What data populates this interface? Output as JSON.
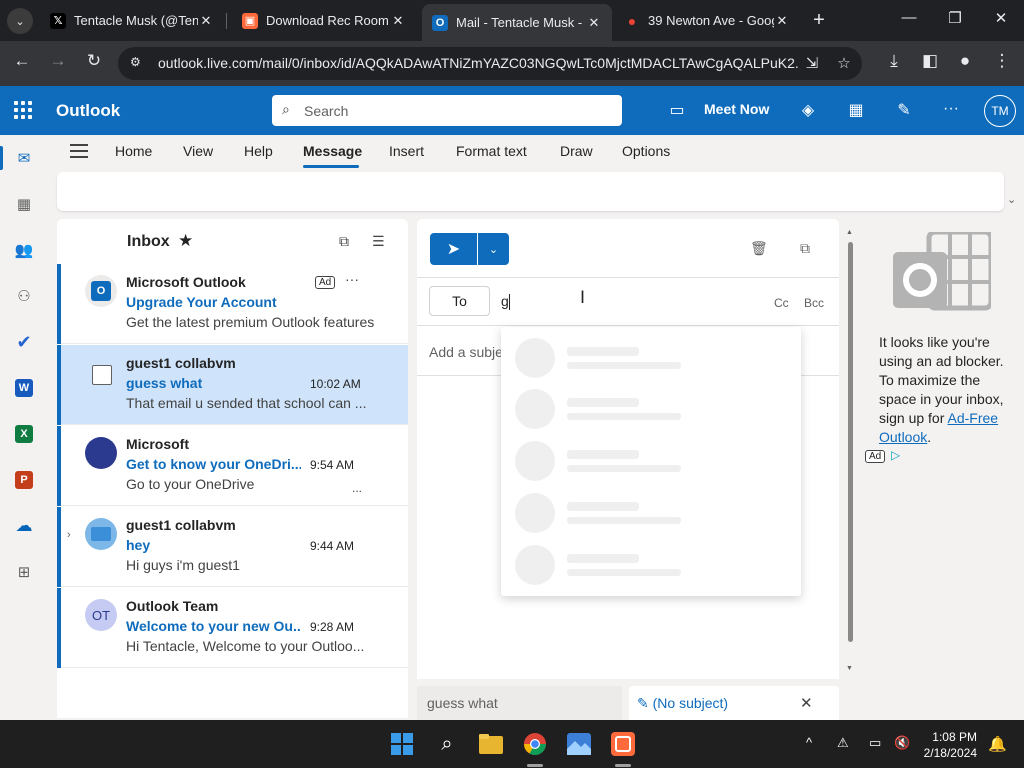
{
  "browser": {
    "tabs": [
      {
        "title": "Tentacle Musk (@Tenta",
        "icon": "x-logo-icon",
        "active": false
      },
      {
        "title": "Download Rec Room",
        "icon": "recroom-icon",
        "active": false
      },
      {
        "title": "Mail - Tentacle Musk -",
        "icon": "outlook-icon",
        "active": true
      },
      {
        "title": "39 Newton Ave - Goog",
        "icon": "maps-pin-icon",
        "active": false
      }
    ],
    "url": "outlook.live.com/mail/0/inbox/id/AQQkADAwATNiZmYAZC03NGQwLTc0MjctMDACLTAwCgAQALPuK2..."
  },
  "outlook": {
    "app_name": "Outlook",
    "search_placeholder": "Search",
    "meet_now": "Meet Now",
    "avatar_initials": "TM",
    "ribbon_tabs": [
      "Home",
      "View",
      "Help",
      "Message",
      "Insert",
      "Format text",
      "Draw",
      "Options"
    ],
    "active_ribbon_tab": "Message"
  },
  "list": {
    "title": "Inbox",
    "items": [
      {
        "sender": "Microsoft Outlook",
        "subject": "Upgrade Your Account",
        "time": "",
        "preview": "Get the latest premium Outlook features",
        "ad": "Ad",
        "more": "···"
      },
      {
        "sender": "guest1 collabvm",
        "subject": "guess what",
        "time": "10:02 AM",
        "preview": "That email u sended that school can ..."
      },
      {
        "sender": "Microsoft",
        "subject": "Get to know your OneDri...",
        "time": "9:54 AM",
        "preview": "Go to your OneDrive",
        "ellipsis": "..."
      },
      {
        "sender": "guest1 collabvm",
        "subject": "hey",
        "time": "9:44 AM",
        "preview": "Hi guys i'm guest1"
      },
      {
        "sender": "Outlook Team",
        "subject": "Welcome to your new Ou...",
        "time": "9:28 AM",
        "preview": "Hi Tentacle, Welcome to your Outloo...",
        "initials": "OT"
      }
    ]
  },
  "compose": {
    "to_label": "To",
    "to_value": "g",
    "cc_label": "Cc",
    "bcc_label": "Bcc",
    "subject_placeholder": "Add a subje"
  },
  "ad_pane": {
    "text": "It looks like you're using an ad blocker. To maximize the space in your inbox, sign up for ",
    "link": "Ad-Free Outlook",
    "after": ".",
    "badge": "Ad"
  },
  "drafts": [
    {
      "label": "guess what"
    },
    {
      "label": "(No subject)"
    }
  ],
  "taskbar": {
    "time": "1:08 PM",
    "date": "2/18/2024"
  }
}
